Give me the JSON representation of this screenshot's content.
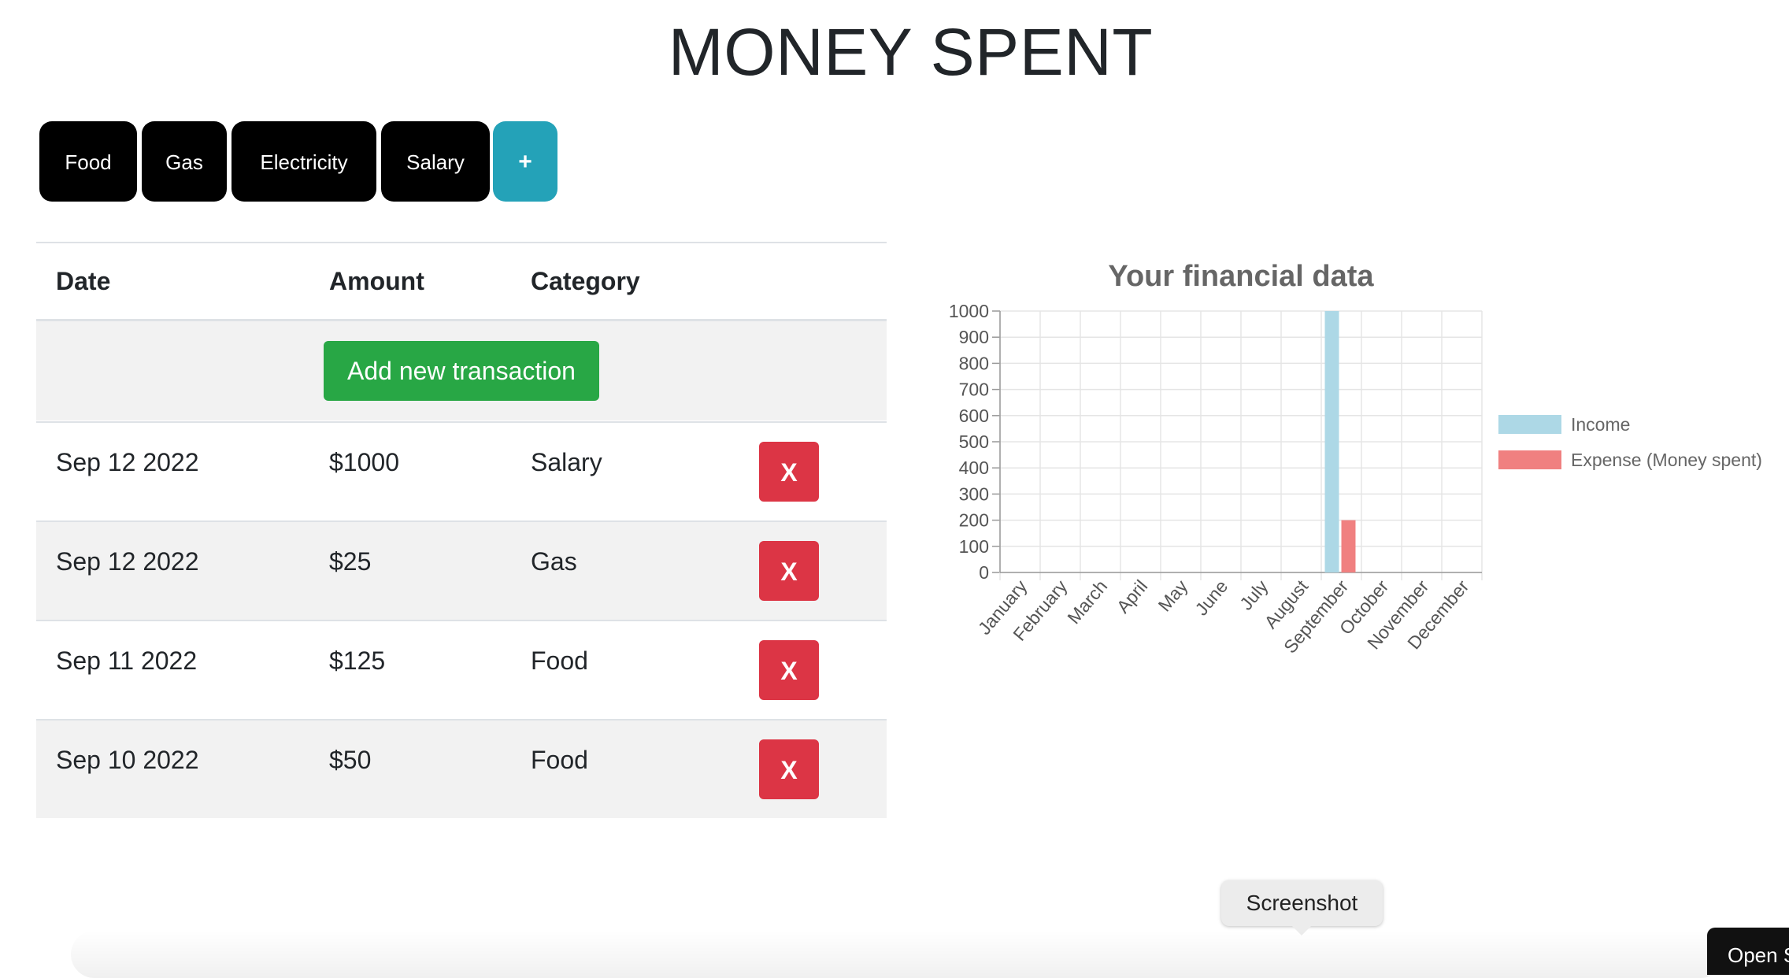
{
  "page_title": "MONEY SPENT",
  "categories": [
    "Food",
    "Gas",
    "Electricity",
    "Salary"
  ],
  "add_category_label": "+",
  "table": {
    "headers": [
      "Date",
      "Amount",
      "Category"
    ],
    "add_transaction_label": "Add new transaction",
    "delete_label": "X",
    "rows": [
      {
        "date": "Sep 12 2022",
        "amount": "$1000",
        "category": "Salary"
      },
      {
        "date": "Sep 12 2022",
        "amount": "$25",
        "category": "Gas"
      },
      {
        "date": "Sep 11 2022",
        "amount": "$125",
        "category": "Food"
      },
      {
        "date": "Sep 10 2022",
        "amount": "$50",
        "category": "Food"
      }
    ]
  },
  "chart_data": {
    "type": "bar",
    "title": "Your financial data",
    "categories": [
      "January",
      "February",
      "March",
      "April",
      "May",
      "June",
      "July",
      "August",
      "September",
      "October",
      "November",
      "December"
    ],
    "series": [
      {
        "name": "Income",
        "color": "#add8e6",
        "values": [
          0,
          0,
          0,
          0,
          0,
          0,
          0,
          0,
          1000,
          0,
          0,
          0
        ]
      },
      {
        "name": "Expense (Money spent)",
        "color": "#f08080",
        "values": [
          0,
          0,
          0,
          0,
          0,
          0,
          0,
          0,
          200,
          0,
          0,
          0
        ]
      }
    ],
    "yticks": [
      0,
      100,
      200,
      300,
      400,
      500,
      600,
      700,
      800,
      900,
      1000
    ],
    "ylim": [
      0,
      1000
    ],
    "grid": true,
    "legend_position": "right"
  },
  "tooltip": "Screenshot",
  "open_button": "Open S"
}
